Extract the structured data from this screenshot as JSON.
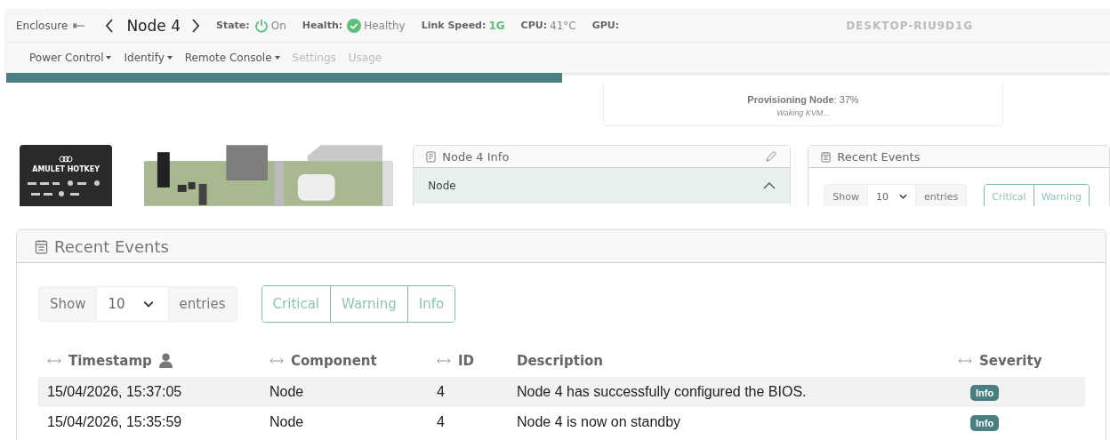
{
  "header": {
    "breadcrumb": "Enclosure",
    "node_title": "Node 4",
    "status": [
      {
        "label": "State:",
        "value": "On",
        "kind": "power"
      },
      {
        "label": "Health:",
        "value": "Healthy",
        "kind": "check"
      },
      {
        "label": "Link Speed:",
        "value": "1G",
        "kind": "green"
      },
      {
        "label": "CPU:",
        "value": "41°C",
        "kind": "plain"
      },
      {
        "label": "GPU:",
        "kind": "plain"
      }
    ],
    "hostname": "DESKTOP-RIU9D1G",
    "menu": [
      {
        "label": "Power Control",
        "dropdown": true,
        "disabled": false
      },
      {
        "label": "Identify",
        "dropdown": true,
        "disabled": false
      },
      {
        "label": "Remote Console",
        "dropdown": true,
        "disabled": false
      },
      {
        "label": "Settings",
        "dropdown": false,
        "disabled": true
      },
      {
        "label": "Usage",
        "dropdown": false,
        "disabled": true
      }
    ]
  },
  "provisioning": {
    "label": "Provisioning Node",
    "value": ": 37%",
    "detail": "Waking KVM..."
  },
  "device_logo": "AMULET HOTKEY",
  "info_panel": {
    "title": "Node 4 Info",
    "section": {
      "label": "Node",
      "expanded": true
    }
  },
  "events_preview": {
    "title": "Recent Events",
    "show": "Show",
    "page_size": "10",
    "entries": "entries",
    "filters": [
      "Critical",
      "Warning"
    ]
  },
  "events": {
    "title": "Recent Events",
    "show": "Show",
    "page_size": "10",
    "entries": "entries",
    "filters": [
      "Critical",
      "Warning",
      "Info"
    ],
    "columns": [
      {
        "label": "Timestamp",
        "kind": "sortable_user"
      },
      {
        "label": "Component",
        "kind": "sortable"
      },
      {
        "label": "ID",
        "kind": "sortable"
      },
      {
        "label": "Description",
        "kind": "plain"
      },
      {
        "label": "Severity",
        "kind": "sortable"
      }
    ],
    "rows": [
      {
        "timestamp": "15/04/2026, 15:37:05",
        "component": "Node",
        "id": "4",
        "description": "Node 4 has successfully configured the BIOS.",
        "severity": "Info"
      },
      {
        "timestamp": "15/04/2026, 15:35:59",
        "component": "Node",
        "id": "4",
        "description": "Node 4 is now on standby",
        "severity": "Info"
      }
    ]
  }
}
